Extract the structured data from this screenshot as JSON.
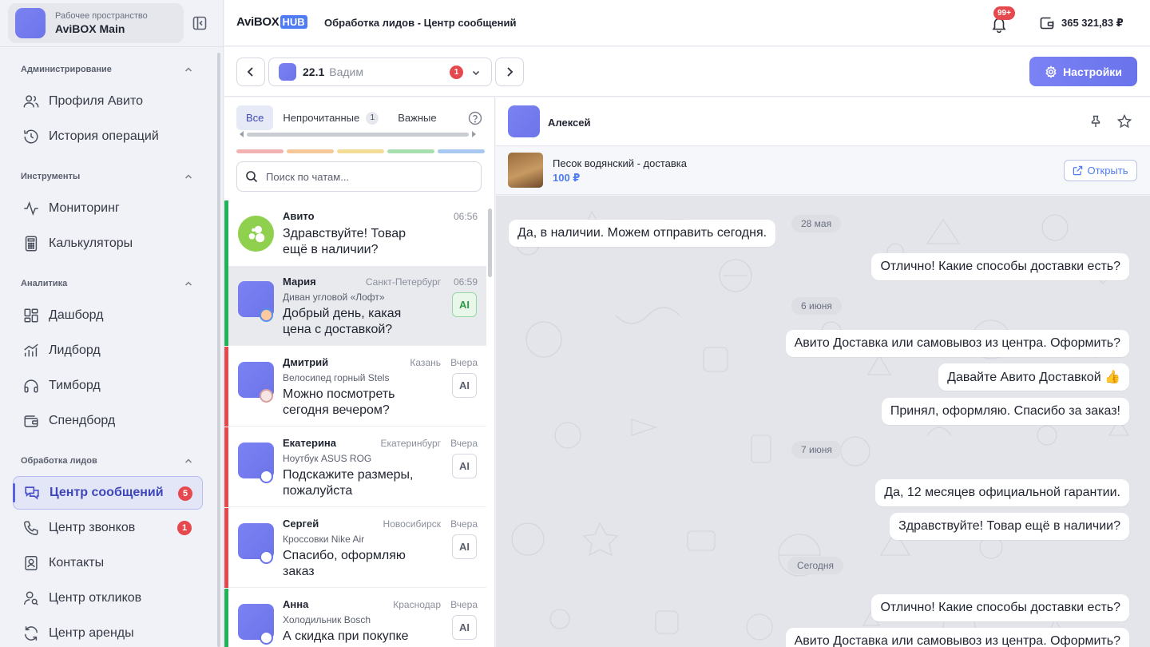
{
  "workspace": {
    "subtitle": "Рабочее пространство",
    "name": "AviBOX Main"
  },
  "sidebar": {
    "sections": [
      {
        "title": "Администрирование",
        "items": [
          {
            "label": "Профиля Авито",
            "icon": "users-icon"
          },
          {
            "label": "История операций",
            "icon": "history-icon"
          }
        ]
      },
      {
        "title": "Инструменты",
        "items": [
          {
            "label": "Мониторинг",
            "icon": "activity-icon"
          },
          {
            "label": "Калькуляторы",
            "icon": "calculator-icon"
          }
        ]
      },
      {
        "title": "Аналитика",
        "items": [
          {
            "label": "Дашборд",
            "icon": "dashboard-icon"
          },
          {
            "label": "Лидборд",
            "icon": "chart-icon"
          },
          {
            "label": "Тимборд",
            "icon": "headphones-icon"
          },
          {
            "label": "Спендборд",
            "icon": "wallet-icon"
          }
        ]
      },
      {
        "title": "Обработка лидов",
        "items": [
          {
            "label": "Центр сообщений",
            "icon": "messages-icon",
            "badge": "5",
            "active": true
          },
          {
            "label": "Центр звонков",
            "icon": "phone-icon",
            "badge": "1"
          },
          {
            "label": "Контакты",
            "icon": "contacts-icon"
          },
          {
            "label": "Центр откликов",
            "icon": "user-search-icon"
          },
          {
            "label": "Центр аренды",
            "icon": "refresh-icon"
          }
        ]
      }
    ]
  },
  "topbar": {
    "brand_main": "AviBOX",
    "brand_badge": "HUB",
    "page_title": "Обработка лидов - Центр сообщений",
    "notifications_badge": "99+",
    "balance": "365 321,83 ₽"
  },
  "account_selector": {
    "number": "22.1",
    "name": "Вадим",
    "badge": "1"
  },
  "settings_label": "Настройки",
  "chat_list": {
    "tabs": [
      {
        "label": "Все",
        "active": true
      },
      {
        "label": "Непрочитанные",
        "count": "1"
      },
      {
        "label": "Важные"
      }
    ],
    "color_filters": [
      "#f3b3b3",
      "#f5c89a",
      "#f3dc95",
      "#a7dfae",
      "#a9c8ef"
    ],
    "search_placeholder": "Поиск по чатам...",
    "chats": [
      {
        "name": "Авито",
        "city": "",
        "time": "06:56",
        "product": "",
        "message": "Здравствуйте! Товар ещё в наличии?",
        "bar_color": "#22b35a",
        "ai": "",
        "avatar": "avito"
      },
      {
        "name": "Мария",
        "city": "Санкт-Петербург",
        "time": "06:59",
        "product": "Диван угловой «Лофт»",
        "message": "Добрый день, какая цена с доставкой?",
        "bar_color": "#22b35a",
        "ai": "AI",
        "ai_active": true,
        "selected": true
      },
      {
        "name": "Дмитрий",
        "city": "Казань",
        "time": "Вчера",
        "product": "Велосипед горный Stels",
        "message": "Можно посмотреть сегодня вечером?",
        "bar_color": "#e5484d",
        "ai": "AI"
      },
      {
        "name": "Екатерина",
        "city": "Екатеринбург",
        "time": "Вчера",
        "product": "Ноутбук ASUS ROG",
        "message": "Подскажите размеры, пожалуйста",
        "bar_color": "#e5484d",
        "ai": "AI"
      },
      {
        "name": "Сергей",
        "city": "Новосибирск",
        "time": "Вчера",
        "product": "Кроссовки Nike Air",
        "message": "Спасибо, оформляю заказ",
        "bar_color": "#e5484d",
        "ai": "AI"
      },
      {
        "name": "Анна",
        "city": "Краснодар",
        "time": "Вчера",
        "product": "Холодильник Bosch",
        "message": "А скидка при покупке",
        "bar_color": "#22b35a",
        "ai": "AI"
      }
    ]
  },
  "chat": {
    "contact_name": "Алексей",
    "product": {
      "title": "Песок водянский - доставка",
      "price": "100 ₽",
      "open_label": "Открыть"
    },
    "messages": [
      {
        "kind": "date",
        "text": "28 мая"
      },
      {
        "kind": "in",
        "text": "Да, в наличии. Можем отправить сегодня."
      },
      {
        "kind": "out",
        "text": "Отлично! Какие способы доставки есть?"
      },
      {
        "kind": "date",
        "text": "6 июня"
      },
      {
        "kind": "out",
        "text": "Авито Доставка или самовывоз из центра. Оформить?"
      },
      {
        "kind": "out",
        "text": "Давайте Авито Доставкой 👍"
      },
      {
        "kind": "out",
        "text": "Принял, оформляю. Спасибо за заказ!"
      },
      {
        "kind": "date",
        "text": "7 июня"
      },
      {
        "kind": "out",
        "text": "Да, 12 месяцев официальной гарантии."
      },
      {
        "kind": "out",
        "text": "Здравствуйте! Товар ещё в наличии?"
      },
      {
        "kind": "date",
        "text": "Сегодня"
      },
      {
        "kind": "out",
        "text": "Отлично! Какие способы доставки есть?"
      },
      {
        "kind": "out",
        "text": "Авито Доставка или самовывоз из центра. Оформить?"
      }
    ]
  }
}
